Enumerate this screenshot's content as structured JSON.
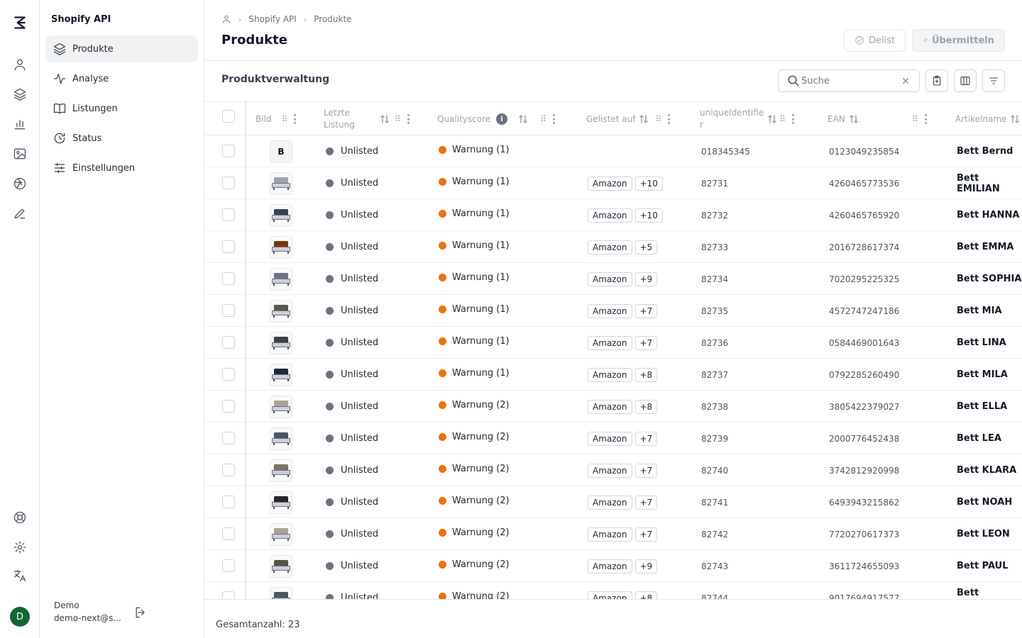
{
  "sidebar": {
    "app_name": "Shopify API",
    "items": [
      {
        "label": "Produkte",
        "icon": "layers-icon",
        "active": true
      },
      {
        "label": "Analyse",
        "icon": "activity-icon"
      },
      {
        "label": "Listungen",
        "icon": "book-icon"
      },
      {
        "label": "Status",
        "icon": "refresh-clock-icon"
      },
      {
        "label": "Einstellungen",
        "icon": "sliders-icon"
      }
    ],
    "user": {
      "name": "Demo",
      "email": "demo-next@s...",
      "avatar": "D"
    }
  },
  "header": {
    "breadcrumb": [
      "Shopify API",
      "Produkte"
    ],
    "title": "Produkte",
    "delist_label": "Delist",
    "submit_label": "Übermitteln"
  },
  "section": {
    "title": "Produktverwaltung",
    "search_placeholder": "Suche"
  },
  "columns": {
    "image": "Bild",
    "last_listing_1": "Letzte",
    "last_listing_2": "Listung",
    "quality": "Qualityscore",
    "listed_on": "Gelistet auf",
    "uid_1": "uniqueIdentifie",
    "uid_2": "r",
    "ean": "EAN",
    "name": "Artikelname"
  },
  "rows": [
    {
      "img": "B",
      "status": "Unlisted",
      "quality": "Warnung (1)",
      "platform": "",
      "extra": "",
      "uid": "018345345",
      "ean": "0123049235854",
      "name": "Bett Bernd"
    },
    {
      "img": "bed",
      "status": "Unlisted",
      "quality": "Warnung (1)",
      "platform": "Amazon",
      "extra": "+10",
      "uid": "82731",
      "ean": "4260465773536",
      "name": "Bett EMILIAN"
    },
    {
      "img": "bed",
      "status": "Unlisted",
      "quality": "Warnung (1)",
      "platform": "Amazon",
      "extra": "+10",
      "uid": "82732",
      "ean": "4260465765920",
      "name": "Bett HANNA"
    },
    {
      "img": "bed",
      "status": "Unlisted",
      "quality": "Warnung (1)",
      "platform": "Amazon",
      "extra": "+5",
      "uid": "82733",
      "ean": "2016728617374",
      "name": "Bett EMMA"
    },
    {
      "img": "bed",
      "status": "Unlisted",
      "quality": "Warnung (1)",
      "platform": "Amazon",
      "extra": "+9",
      "uid": "82734",
      "ean": "7020295225325",
      "name": "Bett SOPHIA"
    },
    {
      "img": "bed",
      "status": "Unlisted",
      "quality": "Warnung (1)",
      "platform": "Amazon",
      "extra": "+7",
      "uid": "82735",
      "ean": "4572747247186",
      "name": "Bett MIA"
    },
    {
      "img": "bed",
      "status": "Unlisted",
      "quality": "Warnung (1)",
      "platform": "Amazon",
      "extra": "+7",
      "uid": "82736",
      "ean": "0584469001643",
      "name": "Bett LINA"
    },
    {
      "img": "bed",
      "status": "Unlisted",
      "quality": "Warnung (1)",
      "platform": "Amazon",
      "extra": "+8",
      "uid": "82737",
      "ean": "0792285260490",
      "name": "Bett MILA"
    },
    {
      "img": "bed",
      "status": "Unlisted",
      "quality": "Warnung (2)",
      "platform": "Amazon",
      "extra": "+8",
      "uid": "82738",
      "ean": "3805422379027",
      "name": "Bett ELLA"
    },
    {
      "img": "bed",
      "status": "Unlisted",
      "quality": "Warnung (2)",
      "platform": "Amazon",
      "extra": "+7",
      "uid": "82739",
      "ean": "2000776452438",
      "name": "Bett LEA"
    },
    {
      "img": "bed",
      "status": "Unlisted",
      "quality": "Warnung (2)",
      "platform": "Amazon",
      "extra": "+7",
      "uid": "82740",
      "ean": "3742812920998",
      "name": "Bett KLARA"
    },
    {
      "img": "bed",
      "status": "Unlisted",
      "quality": "Warnung (2)",
      "platform": "Amazon",
      "extra": "+7",
      "uid": "82741",
      "ean": "6493943215862",
      "name": "Bett NOAH"
    },
    {
      "img": "bed",
      "status": "Unlisted",
      "quality": "Warnung (2)",
      "platform": "Amazon",
      "extra": "+7",
      "uid": "82742",
      "ean": "7720270617373",
      "name": "Bett LEON"
    },
    {
      "img": "bed",
      "status": "Unlisted",
      "quality": "Warnung (2)",
      "platform": "Amazon",
      "extra": "+9",
      "uid": "82743",
      "ean": "3611724655093",
      "name": "Bett PAUL"
    },
    {
      "img": "bed",
      "status": "Unlisted",
      "quality": "Warnung (2)",
      "platform": "Amazon",
      "extra": "+8",
      "uid": "82744",
      "ean": "9017694917577",
      "name": "Bett MATTEO"
    }
  ],
  "footer": {
    "total": "Gesamtanzahl: 23"
  },
  "colors": {
    "warning": "#e8740c",
    "status_dot": "#6b7280",
    "avatar": "#166534"
  }
}
